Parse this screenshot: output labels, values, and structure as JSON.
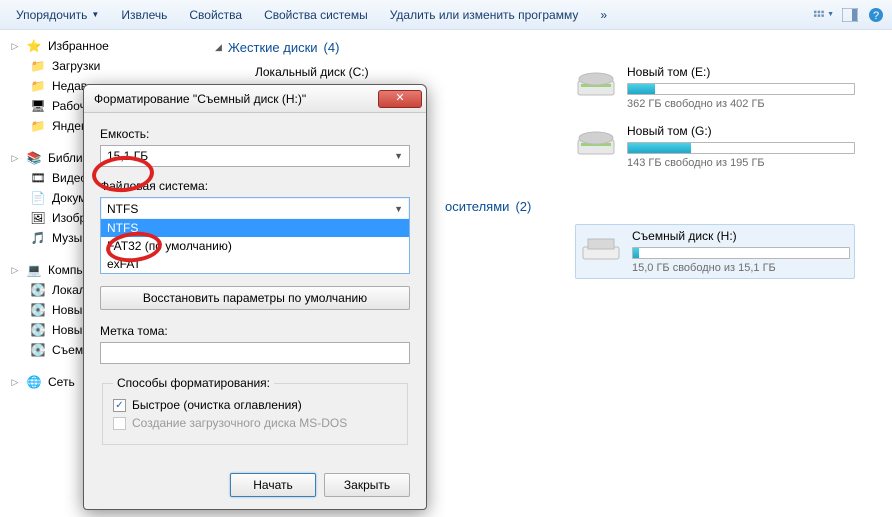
{
  "toolbar": {
    "organize": "Упорядочить",
    "extract": "Извлечь",
    "properties": "Свойства",
    "system_properties": "Свойства системы",
    "uninstall_change": "Удалить или изменить программу"
  },
  "sidebar": {
    "favorites": "Избранное",
    "downloads": "Загрузки",
    "recent": "Недав",
    "desktop": "Рабоч",
    "yandex": "Яндек",
    "libraries": "Библио",
    "videos": "Видео",
    "documents": "Докум",
    "pictures": "Изобр",
    "music": "Музы",
    "computer": "Компь",
    "local": "Локал",
    "new1": "Новы",
    "new2": "Новы",
    "removable": "Съем",
    "network": "Сеть"
  },
  "content": {
    "section_hdd": "Жесткие диски",
    "section_hdd_count": "(4)",
    "section_removable": "осителями",
    "section_removable_count": "(2)",
    "drives": {
      "c": {
        "name": "Локальный диск (C:)"
      },
      "e": {
        "name": "Новый том (E:)",
        "info": "362 ГБ свободно из 402 ГБ",
        "pct": 12
      },
      "g": {
        "name": "Новый том (G:)",
        "info": "143 ГБ свободно из 195 ГБ",
        "pct": 28
      },
      "h": {
        "name": "Съемный диск (H:)",
        "info": "15,0 ГБ свободно из 15,1 ГБ",
        "pct": 3
      }
    }
  },
  "dialog": {
    "title": "Форматирование \"Съемный диск (H:)\"",
    "capacity_label": "Емкость:",
    "capacity_value": "15,1 ГБ",
    "fs_label": "Файловая система:",
    "fs_value": "NTFS",
    "fs_options": {
      "o0": "NTFS",
      "o1": "FAT32 (по умолчанию)",
      "o2": "exFAT"
    },
    "restore_btn": "Восстановить параметры по умолчанию",
    "label_label": "Метка тома:",
    "opts_group": "Способы форматирования:",
    "quick": "Быстрое (очистка оглавления)",
    "msdos": "Создание загрузочного диска MS-DOS",
    "start": "Начать",
    "close": "Закрыть"
  }
}
